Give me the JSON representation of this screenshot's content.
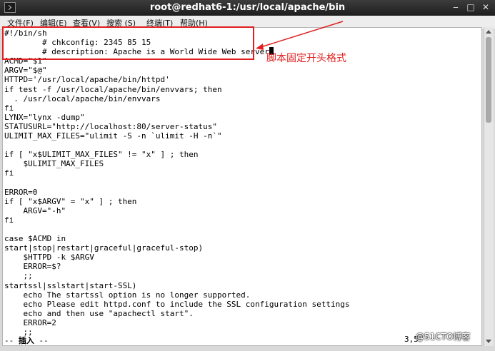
{
  "window": {
    "title": "root@redhat6-1:/usr/local/apache/bin"
  },
  "menu": [
    {
      "label": "文件(F)"
    },
    {
      "label": "编辑(E)"
    },
    {
      "label": "查看(V)"
    },
    {
      "label": "搜索 (S)"
    },
    {
      "label": "终端(T)"
    },
    {
      "label": "帮助(H)"
    }
  ],
  "terminal": {
    "lines": [
      "#!/bin/sh",
      "        # chkconfig: 2345 85 15",
      "        # description: Apache is a World Wide Web server",
      "ACMD=\"$1\"",
      "ARGV=\"$@\"",
      "HTTPD='/usr/local/apache/bin/httpd'",
      "if test -f /usr/local/apache/bin/envvars; then",
      "  . /usr/local/apache/bin/envvars",
      "fi",
      "LYNX=\"lynx -dump\"",
      "STATUSURL=\"http://localhost:80/server-status\"",
      "ULIMIT_MAX_FILES=\"ulimit -S -n `ulimit -H -n`\"",
      "",
      "if [ \"x$ULIMIT_MAX_FILES\" != \"x\" ] ; then",
      "    $ULIMIT_MAX_FILES",
      "fi",
      "",
      "ERROR=0",
      "if [ \"x$ARGV\" = \"x\" ] ; then",
      "    ARGV=\"-h\"",
      "fi",
      "",
      "case $ACMD in",
      "start|stop|restart|graceful|graceful-stop)",
      "    $HTTPD -k $ARGV",
      "    ERROR=$?",
      "    ;;",
      "startssl|sslstart|start-SSL)",
      "    echo The startssl option is no longer supported.",
      "    echo Please edit httpd.conf to include the SSL configuration settings",
      "    echo and then use \"apachectl start\".",
      "    ERROR=2",
      "    ;;"
    ],
    "mode_prefix": "-- ",
    "mode": "插入",
    "mode_suffix": " --",
    "cursor_pos": "3,5"
  },
  "annotation": {
    "text": "脚本固定开头格式",
    "color": "#e02020"
  },
  "watermark": {
    "text": "@51CTO博客"
  }
}
